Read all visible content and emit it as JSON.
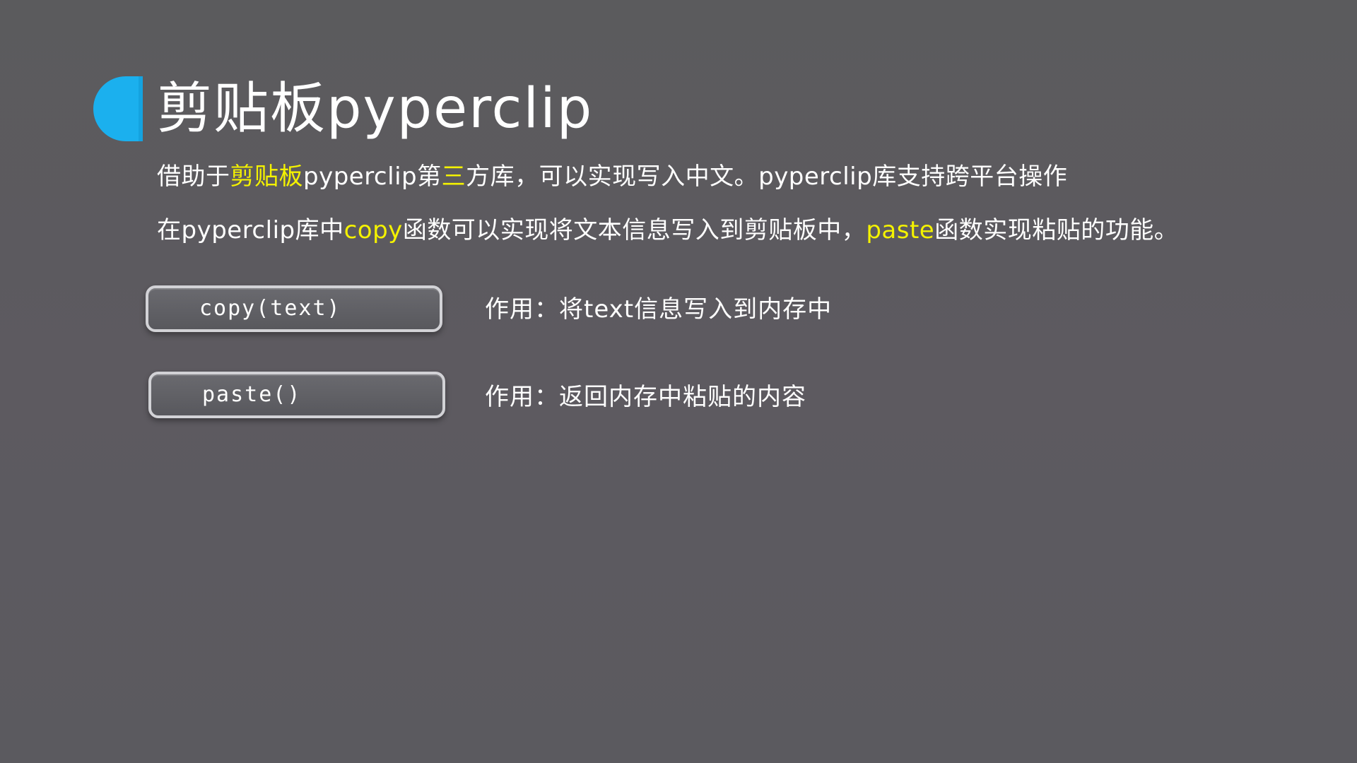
{
  "slide": {
    "title": "剪贴板pyperclip",
    "accent_color": "#1bb0ee",
    "highlight_color": "#f4f200",
    "paragraph1": {
      "part1": "借助于",
      "part2": "剪贴板",
      "part3": "pyperclip第",
      "part4": "三",
      "part5": "方库，可以实现写入中文。pyperclip库支持跨平台操作"
    },
    "paragraph2": {
      "part1": "在pyperclip库中",
      "part2": "copy",
      "part3": "函数可以实现将文本信息写入到剪贴板中，",
      "part4": "paste",
      "part5": "函数实现粘贴的功能。"
    },
    "functions": [
      {
        "name": "copy(text)",
        "description": "作用：将text信息写入到内存中"
      },
      {
        "name": "paste()",
        "description": "作用：返回内存中粘贴的内容"
      }
    ]
  }
}
